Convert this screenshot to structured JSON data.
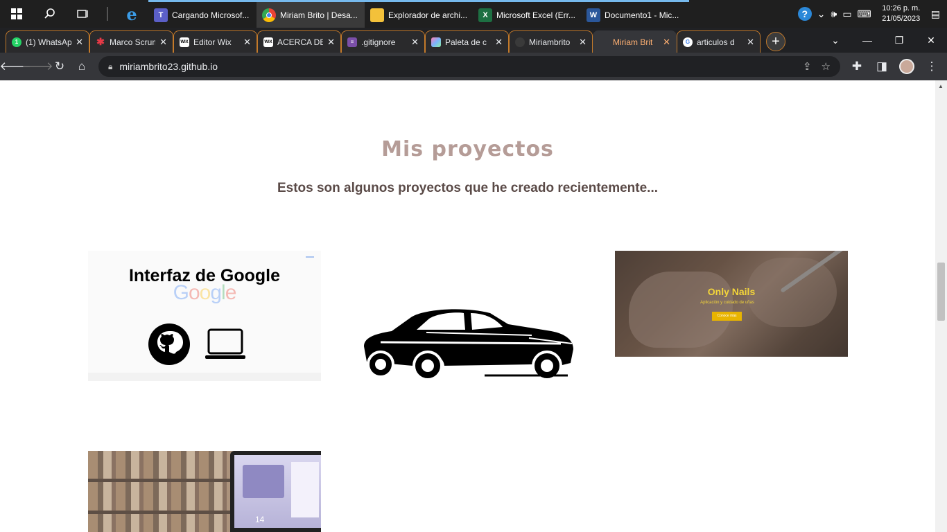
{
  "taskbar": {
    "apps": [
      {
        "label": "Cargando Microsof...",
        "glyph": "T",
        "color": "#5b5fc7"
      },
      {
        "label": "Miriam Brito | Desa...",
        "glyph": "●",
        "color": "#e8453c"
      },
      {
        "label": "Explorador de archi...",
        "glyph": "▀",
        "color": "#f3c13a"
      },
      {
        "label": "Microsoft Excel (Err...",
        "glyph": "X",
        "color": "#1d6f42"
      },
      {
        "label": "Documento1 - Mic...",
        "glyph": "W",
        "color": "#2b579a"
      }
    ],
    "time": "10:26 p. m.",
    "date": "21/05/2023"
  },
  "tabs": [
    {
      "title": "(1) WhatsApp",
      "fav": "1",
      "fav_color": "#25d366"
    },
    {
      "title": "Marco Scrum",
      "fav": "✱",
      "fav_color": "#e63946"
    },
    {
      "title": "Editor Wix",
      "fav": "WIX",
      "fav_color": "#ffffff"
    },
    {
      "title": "ACERCA DE",
      "fav": "WIX",
      "fav_color": "#ffffff"
    },
    {
      "title": ".gitignore",
      "fav": "≡",
      "fav_color": "#c586c0"
    },
    {
      "title": "Paleta de c",
      "fav": "◆",
      "fav_color": "#7bb3ff"
    },
    {
      "title": "Miriambrito",
      "fav": "●",
      "fav_color": "#3a3a3a"
    },
    {
      "title": "Miriam Brit",
      "fav": "",
      "fav_color": "#35363a"
    },
    {
      "title": "articulos d",
      "fav": "G",
      "fav_color": "#ffffff"
    }
  ],
  "toolbar": {
    "url": "miriambrito23.github.io"
  },
  "page": {
    "heading": "Mis proyectos",
    "subheading": "Estos son algunos proyectos que he creado recientemente...",
    "google_card": {
      "title": "Interfaz de Google",
      "logo_text": "Google"
    },
    "nails_card": {
      "title": "Only Nails",
      "subtitle": "Aplicación y cuidado de uñas",
      "button": "Conoce más"
    },
    "laptop_card": {
      "number": "14"
    }
  }
}
